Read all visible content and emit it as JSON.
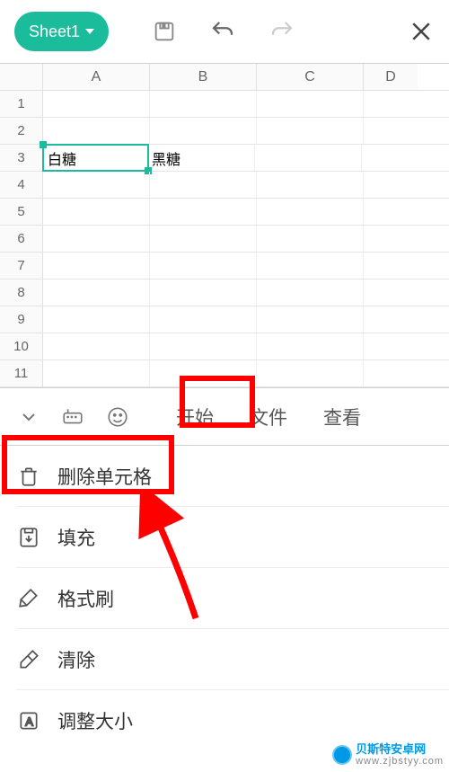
{
  "topbar": {
    "sheet_name": "Sheet1"
  },
  "columns": [
    "A",
    "B",
    "C",
    "D"
  ],
  "rows": [
    1,
    2,
    3,
    4,
    5,
    6,
    7,
    8,
    9,
    10,
    11
  ],
  "cells": {
    "A3": "白糖",
    "B3": "黑糖"
  },
  "selected_cell": "A3",
  "panel": {
    "tabs": {
      "start": "开始",
      "file": "文件",
      "view": "查看"
    },
    "active_tab": "start"
  },
  "menu": {
    "delete_cell": "删除单元格",
    "fill": "填充",
    "format_painter": "格式刷",
    "clear": "清除",
    "resize": "调整大小"
  },
  "watermark": {
    "name": "贝斯特安卓网",
    "url": "www.zjbstyy.com"
  },
  "colors": {
    "accent": "#1abc9c",
    "annotation": "#f00"
  }
}
